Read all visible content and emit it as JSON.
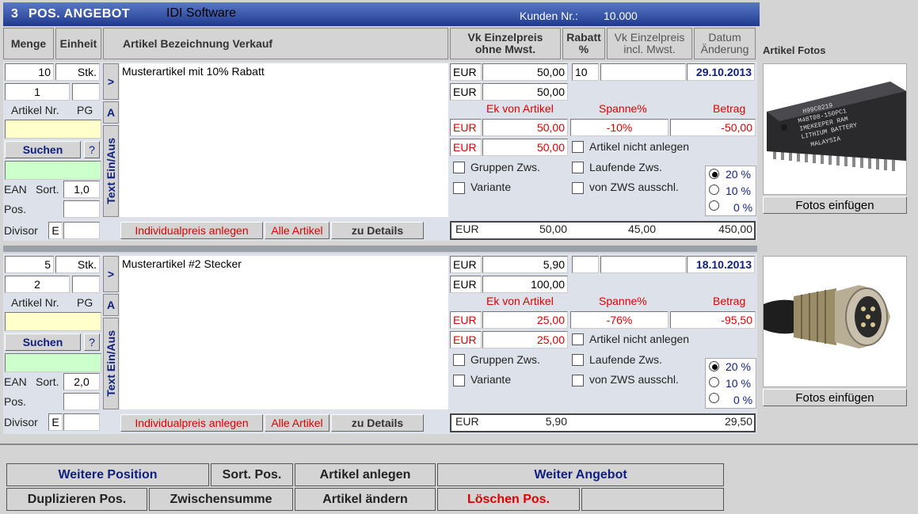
{
  "title": {
    "pos": "3",
    "label": "POS. ANGEBOT",
    "company": "IDI Software",
    "kunden_label": "Kunden Nr.:",
    "kunden_nr": "10.000"
  },
  "columns": {
    "menge": "Menge",
    "einheit": "Einheit",
    "bezeichnung": "Artikel Bezeichnung Verkauf",
    "vk_ohne_1": "Vk Einzelpreis",
    "vk_ohne_2": "ohne Mwst.",
    "rabatt_1": "Rabatt",
    "rabatt_2": "%",
    "vk_incl_1": "Vk Einzelpreis",
    "vk_incl_2": "incl. Mwst.",
    "datum_1": "Datum",
    "datum_2": "Änderung",
    "fotos": "Artikel Fotos"
  },
  "labels": {
    "artikel_nr": "Artikel Nr.",
    "pg": "PG",
    "suchen": "Suchen",
    "help": "?",
    "ean": "EAN",
    "sort": "Sort.",
    "pos": "Pos.",
    "divisor": "Divisor",
    "divisor_val": "E",
    "arrow": ">",
    "tab_a": "A",
    "tab_text": "Text Ein/Aus",
    "eur": "EUR",
    "ek_von_artikel": "Ek von Artikel",
    "spanne": "Spanne%",
    "betrag": "Betrag",
    "artikel_nicht_anlegen": "Artikel nicht anlegen",
    "gruppen_zws": "Gruppen  Zws.",
    "laufende_zws": "Laufende Zws.",
    "variante": "Variante",
    "von_zws": "von ZWS ausschl.",
    "vat": [
      "20 %",
      "10 %",
      "0 %"
    ],
    "individualpreis": "Individualpreis anlegen",
    "alle_artikel": "Alle Artikel",
    "zu_details": "zu Details",
    "fotos_einfuegen": "Fotos einfügen"
  },
  "positions": [
    {
      "menge": "10",
      "einheit": "Stk.",
      "pos_nr": "1",
      "bezeichnung": "Musterartikel mit 10% Rabatt",
      "vk": "50,00",
      "rabatt": "10",
      "vk_incl": "",
      "datum": "29.10.2013",
      "vk2": "50,00",
      "ek": "50,00",
      "spanne": "-10%",
      "betrag": "-50,00",
      "ek2": "50,00",
      "sort": "1,0",
      "sum_eur": "EUR",
      "sum_price": "50,00",
      "sum_mid": "45,00",
      "sum_total": "450,00",
      "photo": "chip-photo"
    },
    {
      "menge": "5",
      "einheit": "Stk.",
      "pos_nr": "2",
      "bezeichnung": "Musterartikel #2 Stecker",
      "vk": "5,90",
      "rabatt": "",
      "vk_incl": "",
      "datum": "18.10.2013",
      "vk2": "100,00",
      "ek": "25,00",
      "spanne": "-76%",
      "betrag": "-95,50",
      "ek2": "25,00",
      "sort": "2,0",
      "sum_eur": "EUR",
      "sum_price": "5,90",
      "sum_mid": "",
      "sum_total": "29,50",
      "photo": "connector-photo"
    }
  ],
  "bottom": {
    "weitere_position": "Weitere Position",
    "sort_pos": "Sort. Pos.",
    "artikel_anlegen": "Artikel anlegen",
    "weiter_angebot": "Weiter Angebot",
    "duplizieren": "Duplizieren Pos.",
    "zwischensumme": "Zwischensumme",
    "artikel_aendern": "Artikel ändern",
    "loeschen": "Löschen Pos."
  }
}
